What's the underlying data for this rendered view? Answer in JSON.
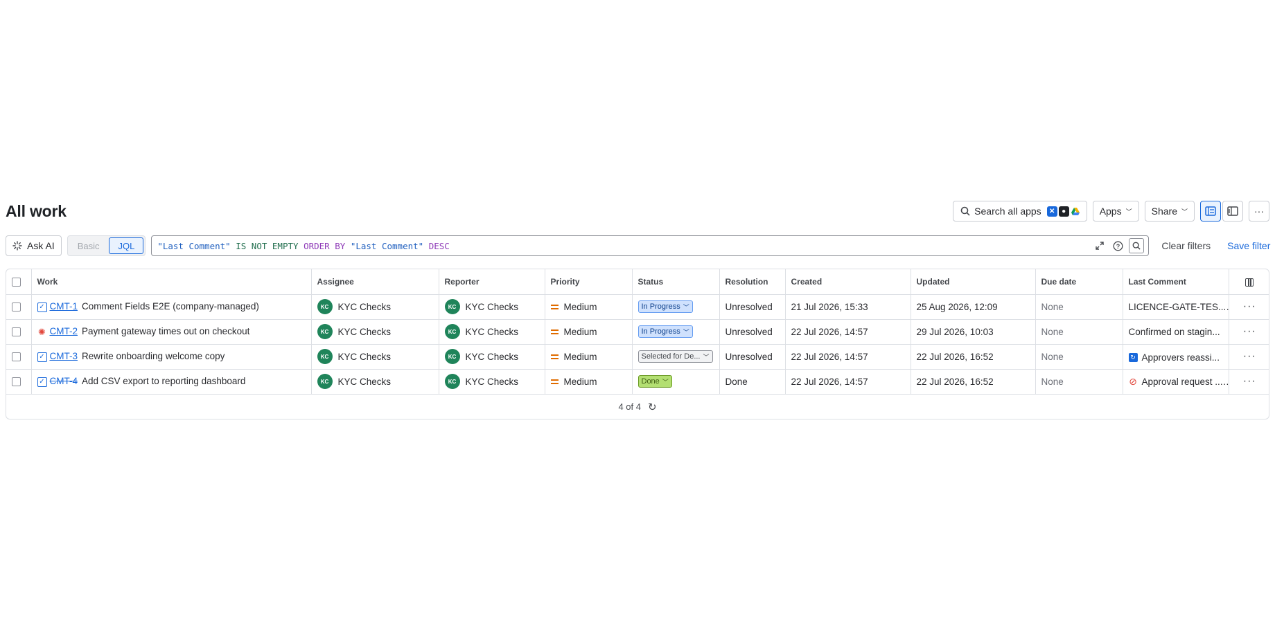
{
  "header": {
    "title": "All work",
    "search_apps_label": "Search all apps",
    "apps_label": "Apps",
    "share_label": "Share"
  },
  "query": {
    "ask_ai_label": "Ask AI",
    "mode_basic": "Basic",
    "mode_jql": "JQL",
    "jql": {
      "field": "\"Last Comment\"",
      "op": "IS NOT EMPTY",
      "order": "ORDER BY",
      "sort_field": "\"Last Comment\"",
      "dir": "DESC"
    },
    "clear_filters_label": "Clear filters",
    "save_filter_label": "Save filter"
  },
  "table": {
    "columns": [
      "Work",
      "Assignee",
      "Reporter",
      "Priority",
      "Status",
      "Resolution",
      "Created",
      "Updated",
      "Due date",
      "Last Comment"
    ],
    "rows": [
      {
        "type": "task",
        "key": "CMT-1",
        "summary": "Comment Fields E2E (company-managed)",
        "assignee": "KYC Checks",
        "assignee_initials": "KC",
        "reporter": "KYC Checks",
        "reporter_initials": "KC",
        "priority": "Medium",
        "status": "In Progress",
        "resolution": "Unresolved",
        "created": "21 Jul 2026, 15:33",
        "updated": "25 Aug 2026, 12:09",
        "due": "None",
        "last_comment": "LICENCE-GATE-TES..."
      },
      {
        "type": "bug",
        "key": "CMT-2",
        "summary": "Payment gateway times out on checkout",
        "assignee": "KYC Checks",
        "assignee_initials": "KC",
        "reporter": "KYC Checks",
        "reporter_initials": "KC",
        "priority": "Medium",
        "status": "In Progress",
        "resolution": "Unresolved",
        "created": "22 Jul 2026, 14:57",
        "updated": "29 Jul 2026, 10:03",
        "due": "None",
        "last_comment": "Confirmed on stagin..."
      },
      {
        "type": "task",
        "key": "CMT-3",
        "summary": "Rewrite onboarding welcome copy",
        "assignee": "KYC Checks",
        "assignee_initials": "KC",
        "reporter": "KYC Checks",
        "reporter_initials": "KC",
        "priority": "Medium",
        "status": "Selected for De...",
        "resolution": "Unresolved",
        "created": "22 Jul 2026, 14:57",
        "updated": "22 Jul 2026, 16:52",
        "due": "None",
        "last_comment": "Approvers reassi..."
      },
      {
        "type": "task",
        "key": "CMT-4",
        "summary": "Add CSV export to reporting dashboard",
        "assignee": "KYC Checks",
        "assignee_initials": "KC",
        "reporter": "KYC Checks",
        "reporter_initials": "KC",
        "priority": "Medium",
        "status": "Done",
        "resolution": "Done",
        "created": "22 Jul 2026, 14:57",
        "updated": "22 Jul 2026, 16:52",
        "due": "None",
        "last_comment": "Approval request ..."
      }
    ],
    "footer_count": "4 of 4"
  },
  "colors": {
    "accent": "#1868db",
    "in_progress_bg": "#cfe1fd",
    "done_bg": "#b3df72",
    "avatar": "#1f845a",
    "priority_medium": "#e06c00"
  }
}
